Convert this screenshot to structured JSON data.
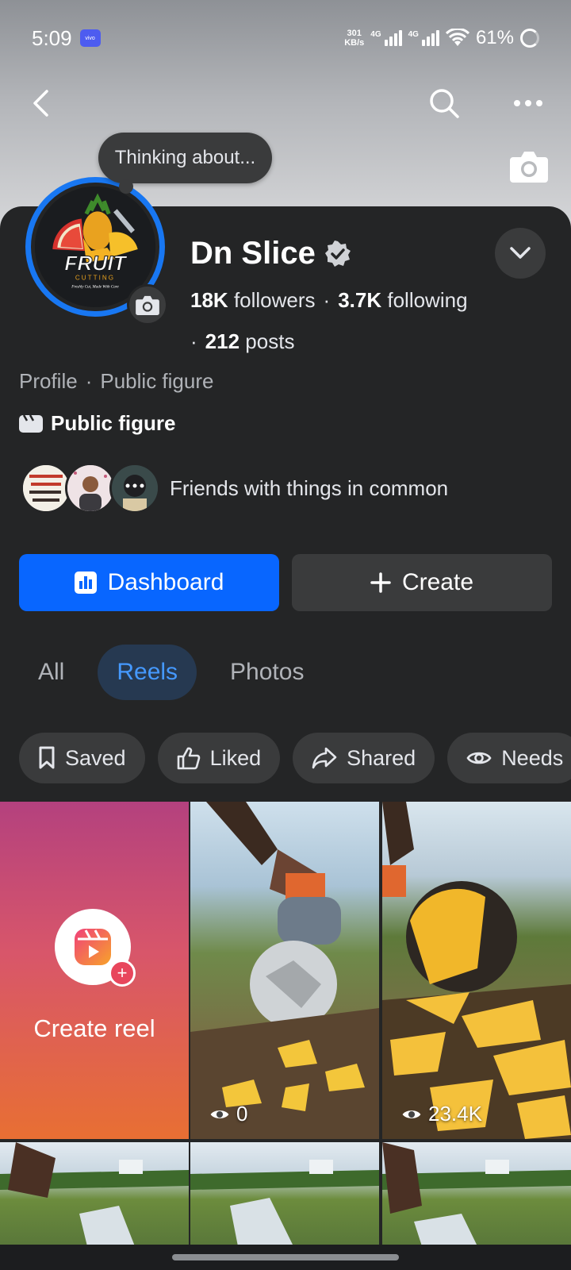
{
  "status_bar": {
    "time": "5:09",
    "carrier_badge": "vivo",
    "net_speed_value": "301",
    "net_speed_unit": "KB/s",
    "network_1": "4G",
    "network_2": "4G",
    "battery": "61%"
  },
  "cover": {
    "thought_bubble": "Thinking about..."
  },
  "profile": {
    "name": "Dn Slice",
    "verified": true,
    "followers_count": "18K",
    "followers_label": "followers",
    "following_count": "3.7K",
    "following_label": "following",
    "posts_count": "212",
    "posts_label": "posts",
    "category_prefix": "Profile",
    "category": "Public figure",
    "page_type": "Public figure",
    "friends_text": "Friends with things in common",
    "avatar_logo": {
      "title": "FRUIT",
      "subtitle": "CUTTING",
      "tagline": "Freshly Cut, Made With Care"
    }
  },
  "actions": {
    "dashboard_label": "Dashboard",
    "create_label": "Create"
  },
  "tabs": [
    {
      "label": "All",
      "active": false
    },
    {
      "label": "Reels",
      "active": true
    },
    {
      "label": "Photos",
      "active": false
    }
  ],
  "chips": [
    {
      "label": "Saved",
      "icon": "bookmark-icon"
    },
    {
      "label": "Liked",
      "icon": "thumbs-up-icon"
    },
    {
      "label": "Shared",
      "icon": "share-icon"
    },
    {
      "label": "Needs",
      "icon": "eye-icon"
    }
  ],
  "grid": {
    "create_reel_label": "Create reel",
    "reels": [
      {
        "views": "0"
      },
      {
        "views": "23.4K"
      }
    ]
  },
  "colors": {
    "accent": "#0866ff",
    "tab_active_bg": "#263951",
    "tab_active_text": "#4599ff",
    "card_bg": "#242526"
  }
}
